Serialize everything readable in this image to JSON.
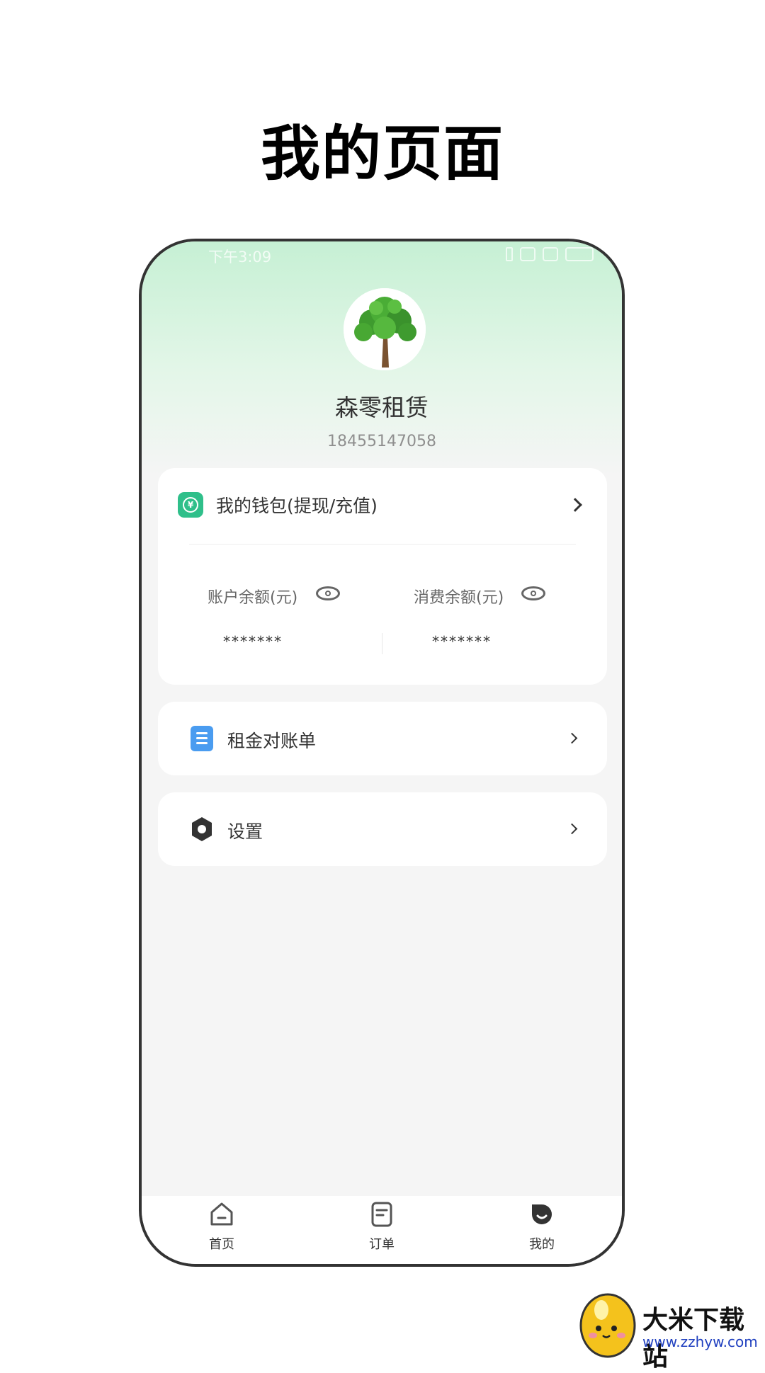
{
  "page": {
    "heading": "我的页面"
  },
  "status_bar": {
    "time": "下午3:09"
  },
  "profile": {
    "name": "森零租赁",
    "phone": "18455147058"
  },
  "wallet": {
    "label": "我的钱包(提现/充值)",
    "account_balance_label": "账户余额(元)",
    "account_balance_value": "*******",
    "consume_balance_label": "消费余额(元)",
    "consume_balance_value": "*******"
  },
  "menu": {
    "rent_statement": "租金对账单",
    "settings": "设置"
  },
  "tabbar": {
    "items": [
      {
        "label": "首页",
        "icon": "home-icon"
      },
      {
        "label": "订单",
        "icon": "order-icon"
      },
      {
        "label": "我的",
        "icon": "profile-icon",
        "active": true
      }
    ]
  },
  "watermark": {
    "title": "大米下载站",
    "url": "www.zzhyw.com"
  },
  "colors": {
    "accent_green": "#2fbf8a",
    "doc_blue": "#4a9cf0",
    "header_gradient": "#c6f0d4"
  }
}
